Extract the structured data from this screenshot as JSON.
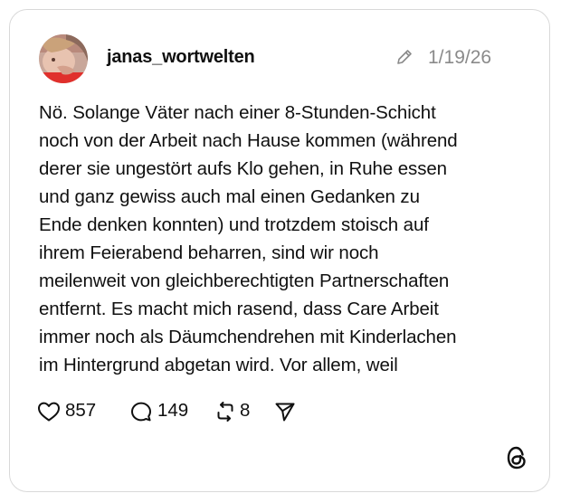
{
  "post": {
    "username": "janas_wortwelten",
    "date": "1/19/26",
    "body_lines": [
      "Nö. Solange Väter nach einer 8-Stunden-Schicht",
      "noch von der Arbeit nach Hause kommen (während",
      "derer sie ungestört aufs Klo gehen, in Ruhe essen",
      "und ganz gewiss auch mal einen Gedanken zu",
      "Ende denken konnten) und trotzdem stoisch auf",
      "ihrem Feierabend beharren, sind wir noch",
      "meilenweit von gleichberechtigten Partnerschaften",
      "entfernt. Es macht mich rasend, dass Care Arbeit",
      "immer noch als Däumchendrehen mit Kinderlachen",
      "im Hintergrund abgetan wird. Vor allem, weil"
    ]
  },
  "actions": {
    "likes": "857",
    "replies": "149",
    "reposts": "8"
  },
  "icons": {
    "edited": "pencil-icon",
    "like": "heart-icon",
    "reply": "speech-bubble-icon",
    "repost": "repost-icon",
    "share": "send-icon",
    "brand": "threads-logo"
  },
  "colors": {
    "border": "#d9d9d9",
    "text": "#101010",
    "muted": "#8a8a8a"
  }
}
